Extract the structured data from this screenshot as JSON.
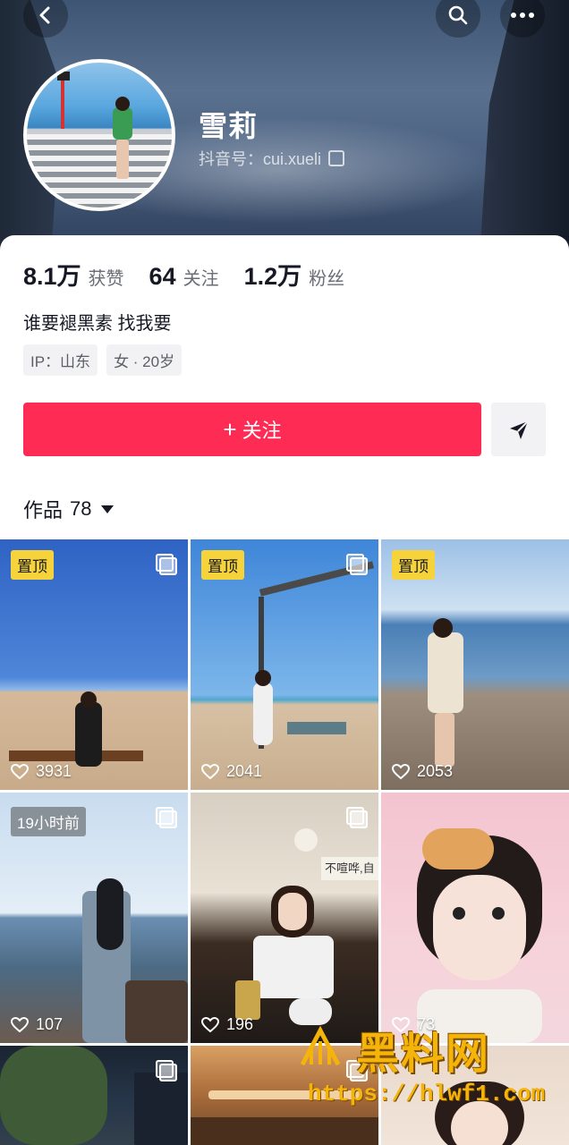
{
  "profile": {
    "name": "雪莉",
    "douyin_id": "抖音号：cui.xueli",
    "bio": "谁要褪黑素 找我要",
    "tags": [
      "IP：山东",
      "女 · 20岁"
    ]
  },
  "stats": [
    {
      "num": "8.1万",
      "label": "获赞"
    },
    {
      "num": "64",
      "label": "关注"
    },
    {
      "num": "1.2万",
      "label": "粉丝"
    }
  ],
  "actions": {
    "follow_plus": "+",
    "follow_label": "关注"
  },
  "works": {
    "label": "作品",
    "count": "78"
  },
  "videos": [
    {
      "badge": "置顶",
      "likes": "3931"
    },
    {
      "badge": "置顶",
      "likes": "2041"
    },
    {
      "badge": "置顶",
      "likes": "2053"
    },
    {
      "badge": "19小时前",
      "likes": "107"
    },
    {
      "badge": "",
      "likes": "196"
    },
    {
      "badge": "",
      "likes": "73"
    }
  ],
  "restaurant_sign": "不喧哗,自",
  "watermark": {
    "title": "黑料网",
    "url": "https://hlwf1.com"
  },
  "colors": {
    "accent": "#fe2c55",
    "pin": "#f6d33b",
    "watermark": "#f5b40a"
  }
}
